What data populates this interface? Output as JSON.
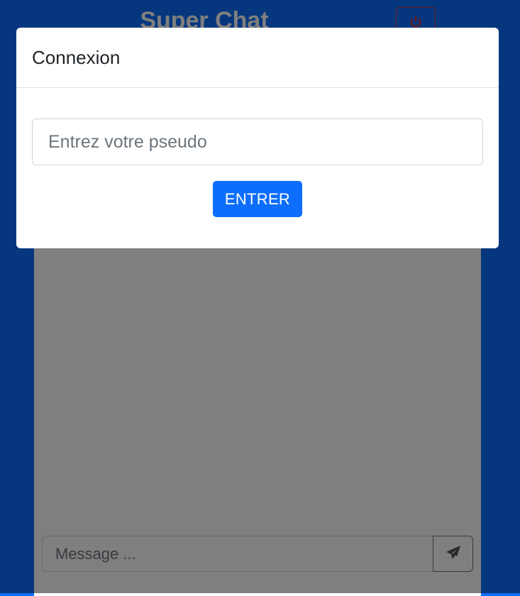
{
  "app": {
    "title": "Super Chat",
    "logout_icon": "power-icon",
    "background_color": "#0d6efd",
    "panel_color": "#ffffff"
  },
  "composer": {
    "message_placeholder": "Message ...",
    "message_value": "",
    "send_icon": "paper-plane-icon"
  },
  "login_modal": {
    "title": "Connexion",
    "pseudo_placeholder": "Entrez votre pseudo",
    "pseudo_value": "",
    "enter_label": "ENTRER",
    "enter_color": "#0d6efd"
  }
}
